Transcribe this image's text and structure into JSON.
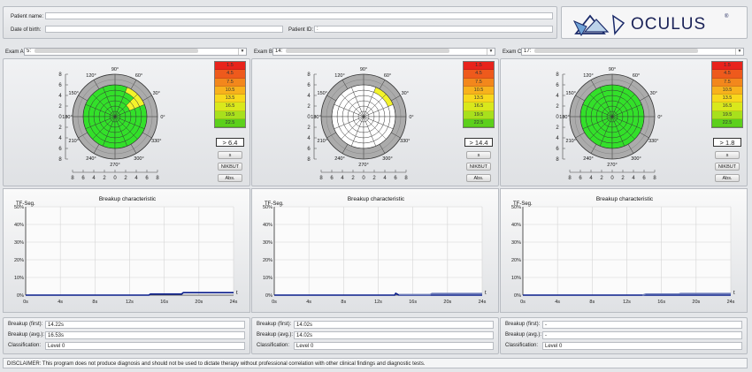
{
  "header": {
    "patient_name_label": "Patient name:",
    "patient_name_value": "",
    "dob_label": "Date of birth:",
    "dob_value": "",
    "patient_id_label": "Patient ID:",
    "patient_id_value": ":",
    "logo_text": "OCULUS",
    "logo_mark": "®"
  },
  "exams": [
    {
      "label": "Exam A:",
      "value": "5:",
      "value_display": "> 6.4",
      "s_label": "s",
      "nikbut_label": "NIKBUT",
      "abs_label": "Abs.",
      "breakup_first_label": "Breakup (first):",
      "breakup_first": "14.22s",
      "breakup_avg_label": "Breakup (avg.):",
      "breakup_avg": "16.53s",
      "classification_label": "Classification:",
      "classification": "Level 0",
      "grid": "mostly-green-one-yellow"
    },
    {
      "label": "Exam B:",
      "value": "14:",
      "value_display": "> 14.4",
      "s_label": "s",
      "nikbut_label": "NIKBUT",
      "abs_label": "Abs.",
      "breakup_first_label": "Breakup (first):",
      "breakup_first": "14.02s",
      "breakup_avg_label": "Breakup (avg.):",
      "breakup_avg": "14.02s",
      "classification_label": "Classification:",
      "classification": "Level 0",
      "grid": "mostly-white-one-yellow"
    },
    {
      "label": "Exam C:",
      "value": "17:",
      "value_display": "> 1.8",
      "s_label": "s",
      "nikbut_label": "NIKBUT",
      "abs_label": "Abs.",
      "breakup_first_label": "Breakup (first):",
      "breakup_first": "-",
      "breakup_avg_label": "Breakup (avg.):",
      "breakup_avg": "-",
      "classification_label": "Classification:",
      "classification": "Level 0",
      "grid": "all-green"
    }
  ],
  "scale": {
    "labels": [
      "1.5",
      "4.5",
      "7.5",
      "10.5",
      "13.5",
      "16.5",
      "19.5",
      "22.5"
    ],
    "colors": [
      "#e8231c",
      "#ee5a1c",
      "#f3871c",
      "#f8b21c",
      "#f8d81c",
      "#d9e81c",
      "#a8e01c",
      "#5cd01c"
    ]
  },
  "polar": {
    "angle_labels": [
      "90°",
      "60°",
      "30°",
      "0°",
      "330°",
      "300°",
      "270°",
      "240°",
      "210°",
      "180°",
      "150°",
      "120°"
    ],
    "axis_labels": [
      "8",
      "6",
      "4",
      "2",
      "0",
      "2",
      "4",
      "6",
      "8"
    ],
    "green": "#33e02a",
    "yellow": "#f3f32a",
    "ring_color": "#ababab"
  },
  "chart_data": [
    {
      "type": "line",
      "title": "Breakup characteristic",
      "ylabel": "TF-Seg.",
      "xlabel": "t",
      "x_ticks": [
        "0s",
        "4s",
        "8s",
        "12s",
        "16s",
        "20s",
        "24s"
      ],
      "y_ticks": [
        "0%",
        "10%",
        "20%",
        "30%",
        "40%",
        "50%"
      ],
      "xlim": [
        0,
        24
      ],
      "ylim": [
        0,
        50
      ],
      "series": [
        {
          "color": "#0a1e8c",
          "x": [
            0,
            14.22,
            14.4,
            18,
            18.2,
            24
          ],
          "y": [
            0,
            0,
            0.6,
            0.6,
            1.4,
            1.4
          ]
        }
      ]
    },
    {
      "type": "line",
      "title": "Breakup characteristic",
      "ylabel": "TF-Seg.",
      "xlabel": "t",
      "x_ticks": [
        "0s",
        "4s",
        "8s",
        "12s",
        "16s",
        "20s",
        "24s"
      ],
      "y_ticks": [
        "0%",
        "10%",
        "20%",
        "30%",
        "40%",
        "50%"
      ],
      "xlim": [
        0,
        24
      ],
      "ylim": [
        0,
        50
      ],
      "series": [
        {
          "color": "#0a1e8c",
          "x": [
            0,
            13.9,
            14.02,
            14.4,
            24
          ],
          "y": [
            0,
            0,
            1,
            0,
            0
          ]
        },
        {
          "color": "#6a7ab8",
          "x": [
            14.4,
            18,
            18.2,
            24
          ],
          "y": [
            0.3,
            0.3,
            0.9,
            0.9
          ]
        }
      ]
    },
    {
      "type": "line",
      "title": "Breakup characteristic",
      "ylabel": "TF-Seg.",
      "xlabel": "t",
      "x_ticks": [
        "0s",
        "4s",
        "8s",
        "12s",
        "16s",
        "20s",
        "24s"
      ],
      "y_ticks": [
        "0%",
        "10%",
        "20%",
        "30%",
        "40%",
        "50%"
      ],
      "xlim": [
        0,
        24
      ],
      "ylim": [
        0,
        50
      ],
      "series": [
        {
          "color": "#0a1e8c",
          "x": [
            0,
            24
          ],
          "y": [
            0,
            0
          ]
        },
        {
          "color": "#6a7ab8",
          "x": [
            13.8,
            14.2,
            18,
            18.2,
            24
          ],
          "y": [
            0,
            0.6,
            0.6,
            0.9,
            0.9
          ]
        }
      ]
    }
  ],
  "disclaimer": "DISCLAIMER: This program does not produce diagnosis and should not be used to dictate therapy without professional correlation with other clinical findings and diagnostic tests."
}
